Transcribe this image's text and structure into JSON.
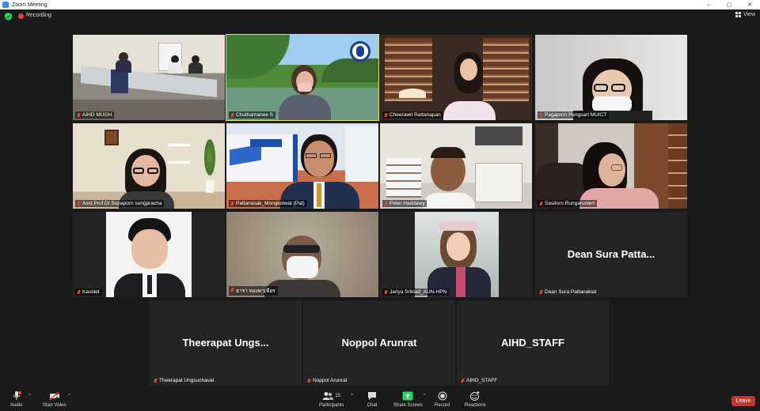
{
  "window": {
    "title": "Zoom Meeting",
    "controls": [
      "–",
      "▢",
      "✕"
    ]
  },
  "topbar": {
    "recording_label": "Recording",
    "view_label": "View"
  },
  "participants_tiles": [
    {
      "name": "AIHD MUGH",
      "muted": false
    },
    {
      "name": "Chuthamanee  S",
      "muted": false,
      "active_speaker": true
    },
    {
      "name": "Cheerawit Rattanapan",
      "muted": true
    },
    {
      "name": "Pagaporn Pengsart MUICT",
      "muted": true
    },
    {
      "name": "Asst.Prof.Dr.Supaporn songpracha",
      "muted": true
    },
    {
      "name": "Pattanasak_Mongkolwat (Pat)",
      "muted": true
    },
    {
      "name": "Peter Haddawy",
      "muted": true
    },
    {
      "name": "Sasitorn Rungarunlert",
      "muted": true
    },
    {
      "name": "Kasidet",
      "muted": true
    },
    {
      "name": "ธารา ทองพาเพียร",
      "muted": true
    },
    {
      "name": "Jariya Sriklad_AUN-HPN",
      "muted": false
    },
    {
      "name": "Dean Sura Pattanakiat",
      "muted": true,
      "display_name": "Dean Sura Patta..."
    },
    {
      "name": "Theerapat Ungsuchaval",
      "muted": true,
      "display_name": "Theerapat  Ungs..."
    },
    {
      "name": "Noppol Arunrat",
      "muted": true,
      "display_name": "Noppol Arunrat"
    },
    {
      "name": "AIHD_STAFF",
      "muted": true,
      "display_name": "AIHD_STAFF"
    }
  ],
  "toolbar": {
    "audio_label": "Audio",
    "video_label": "Start Video",
    "participants_label": "Participants",
    "participants_count": "15",
    "chat_label": "Chat",
    "share_label": "Share Screen",
    "record_label": "Record",
    "reactions_label": "Reactions",
    "leave_label": "Leave"
  },
  "colors": {
    "background": "#1a1a1a",
    "active_speaker_border": "#d9e26b",
    "share_green": "#23d959",
    "leave_red": "#c8372d",
    "recording_red": "#e8453c"
  }
}
